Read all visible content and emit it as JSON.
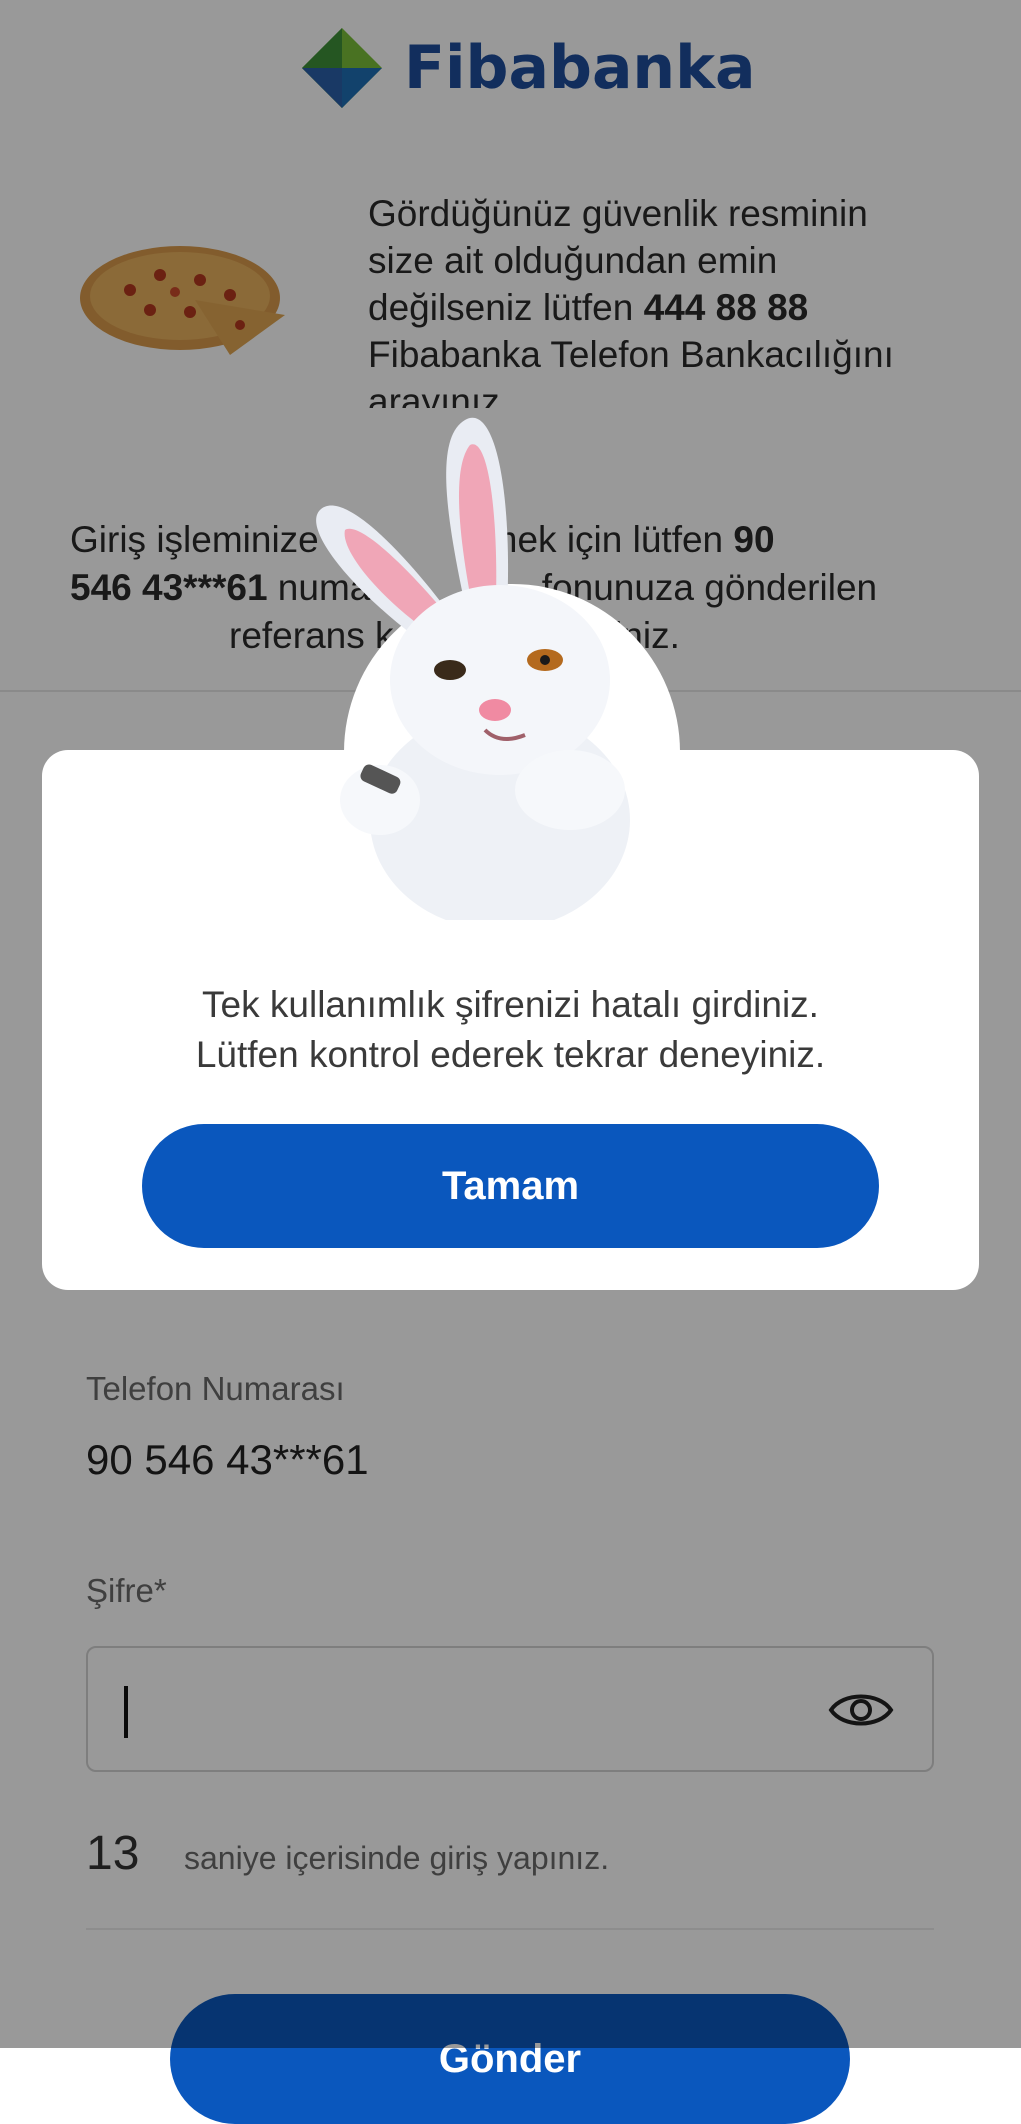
{
  "brand": {
    "name": "Fibabanka"
  },
  "security_image": {
    "text_line1": "Gördüğünüz güvenlik resminin",
    "text_line2": "size ait olduğundan emin",
    "text_line3_pre": "değilseniz lütfen ",
    "phone_number": "444 88 88",
    "text_line4": "Fibabanka Telefon Bankacılığını",
    "text_line5": "arayınız."
  },
  "info": {
    "part1": "Giriş işleminize de",
    "part2": "ilmek için lütfen ",
    "masked_phone_a": "90",
    "masked_phone_b": "546 43***61",
    "part3": " numaralı",
    "part4": "fonunuza gönderilen",
    "part5": "referans k",
    "part6": "iriniz."
  },
  "form": {
    "phone_label": "Telefon Numarası",
    "phone_value": "90 546 43***61",
    "password_label": "Şifre*",
    "countdown_value": "13",
    "countdown_text": "saniye içerisinde giriş yapınız.",
    "submit_label": "Gönder"
  },
  "modal": {
    "message_line1": "Tek kullanımlık şifrenizi hatalı girdiniz.",
    "message_line2": "Lütfen kontrol ederek tekrar deneyiniz.",
    "ok_label": "Tamam"
  },
  "colors": {
    "brand_blue": "#1e4e9c",
    "button_blue": "#0a57bd",
    "overlay": "rgba(0,0,0,0.40)"
  }
}
